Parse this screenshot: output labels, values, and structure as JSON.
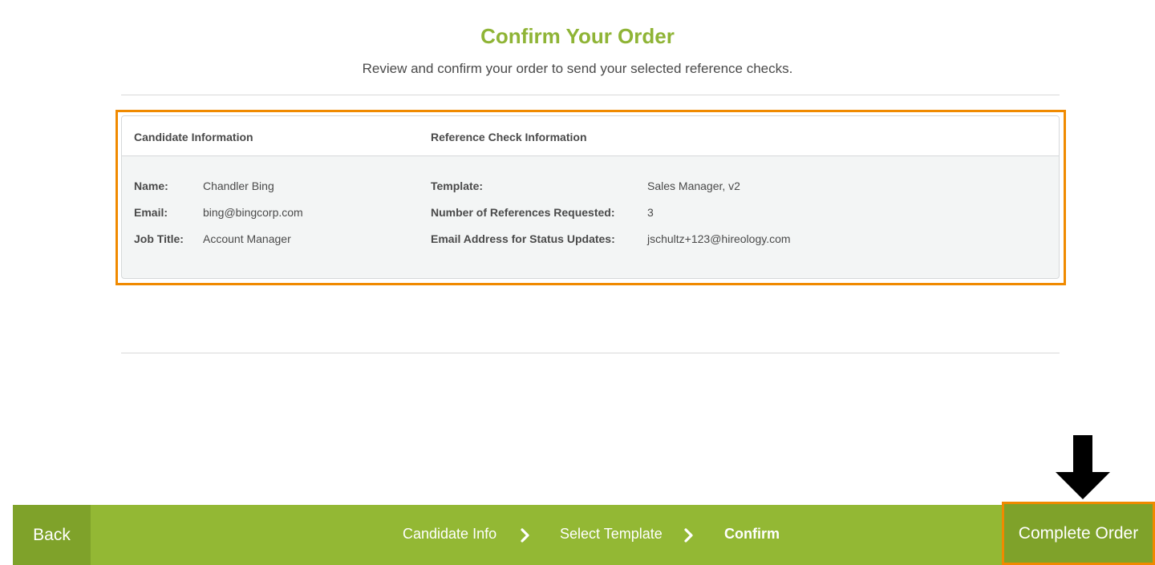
{
  "header": {
    "title": "Confirm Your Order",
    "subtitle": "Review and confirm your order to send your selected reference checks."
  },
  "summary": {
    "candidate_heading": "Candidate Information",
    "reference_heading": "Reference Check Information",
    "candidate": [
      {
        "label": "Name:",
        "value": "Chandler Bing"
      },
      {
        "label": "Email:",
        "value": "bing@bingcorp.com"
      },
      {
        "label": "Job Title:",
        "value": "Account Manager"
      }
    ],
    "reference": [
      {
        "label": "Template:",
        "value": "Sales Manager, v2"
      },
      {
        "label": "Number of References Requested:",
        "value": "3"
      },
      {
        "label": "Email Address for Status Updates:",
        "value": "jschultz+123@hireology.com"
      }
    ]
  },
  "footer": {
    "back_label": "Back",
    "steps": [
      {
        "label": "Candidate Info"
      },
      {
        "label": "Select Template"
      },
      {
        "label": "Confirm"
      }
    ],
    "complete_label": "Complete Order"
  },
  "colors": {
    "accent": "#93b834",
    "accent_dark": "#7fa22a",
    "title": "#8fb436",
    "highlight": "#f08a00"
  },
  "icons": {
    "step_separator": "chevron-right-icon",
    "annotation": "arrow-down-icon"
  }
}
